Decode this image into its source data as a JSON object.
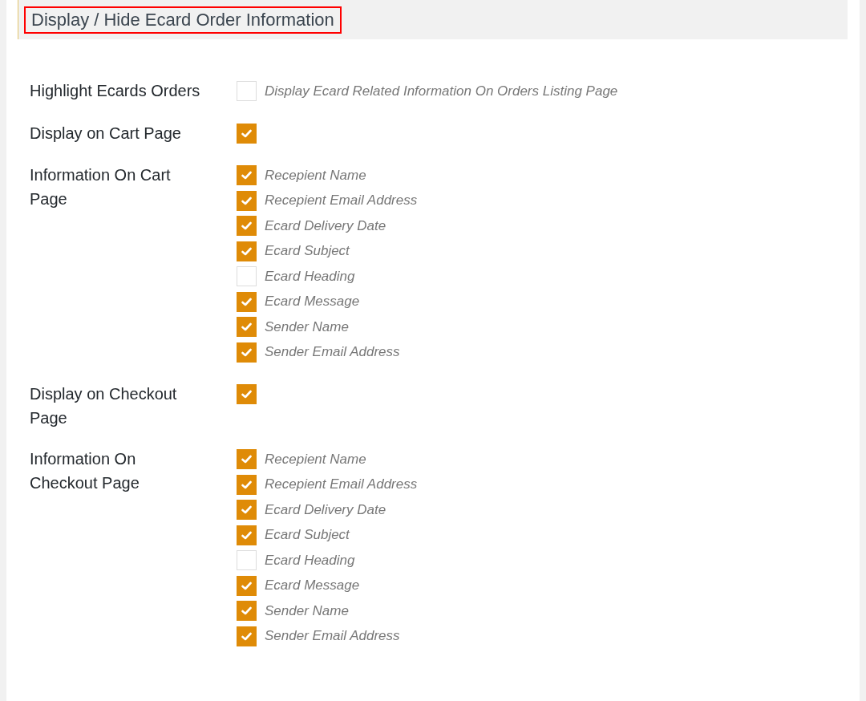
{
  "section": {
    "title": "Display / Hide Ecard Order Information"
  },
  "settings": [
    {
      "label": "Highlight Ecards Orders",
      "options": [
        {
          "label": "Display Ecard Related Information On Orders Listing Page",
          "checked": false
        }
      ]
    },
    {
      "label": "Display on Cart Page",
      "options": [
        {
          "checked": true
        }
      ]
    },
    {
      "label": "Information On Cart Page",
      "options": [
        {
          "label": "Recepient Name",
          "checked": true
        },
        {
          "label": "Recepient Email Address",
          "checked": true
        },
        {
          "label": "Ecard Delivery Date",
          "checked": true
        },
        {
          "label": "Ecard Subject",
          "checked": true
        },
        {
          "label": "Ecard Heading",
          "checked": false
        },
        {
          "label": "Ecard Message",
          "checked": true
        },
        {
          "label": "Sender Name",
          "checked": true
        },
        {
          "label": "Sender Email Address",
          "checked": true
        }
      ]
    },
    {
      "label": "Display on Checkout Page",
      "options": [
        {
          "checked": true
        }
      ]
    },
    {
      "label": "Information On Checkout Page",
      "options": [
        {
          "label": "Recepient Name",
          "checked": true
        },
        {
          "label": "Recepient Email Address",
          "checked": true
        },
        {
          "label": "Ecard Delivery Date",
          "checked": true
        },
        {
          "label": "Ecard Subject",
          "checked": true
        },
        {
          "label": "Ecard Heading",
          "checked": false
        },
        {
          "label": "Ecard Message",
          "checked": true
        },
        {
          "label": "Sender Name",
          "checked": true
        },
        {
          "label": "Sender Email Address",
          "checked": true
        }
      ]
    }
  ]
}
